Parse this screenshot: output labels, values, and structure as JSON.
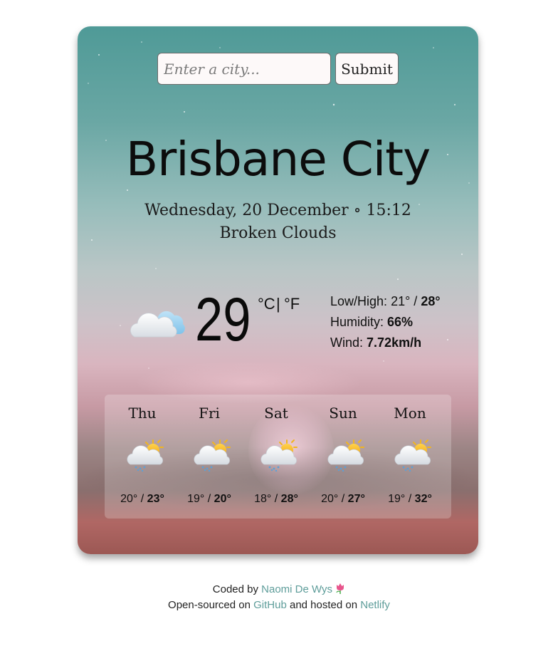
{
  "search": {
    "placeholder": "Enter a city...",
    "value": "",
    "submit_label": "Submit"
  },
  "current": {
    "city": "Brisbane City",
    "date_time": "Wednesday, 20 December ∘ 15:12",
    "description": "Broken Clouds",
    "icon": "cloud-icon",
    "temperature": "29",
    "unit_c": "°C",
    "unit_sep": "|",
    "unit_f": "°F",
    "low_high_label": "Low/High:",
    "low": "21°",
    "high": "28°",
    "humidity_label": "Humidity:",
    "humidity": "66%",
    "wind_label": "Wind:",
    "wind": "7.72km/h"
  },
  "forecast": [
    {
      "day": "Thu",
      "icon": "sun-cloud-rain-icon",
      "low": "20°",
      "high": "23°"
    },
    {
      "day": "Fri",
      "icon": "sun-cloud-rain-icon",
      "low": "19°",
      "high": "20°"
    },
    {
      "day": "Sat",
      "icon": "sun-cloud-rain-icon",
      "low": "18°",
      "high": "28°"
    },
    {
      "day": "Sun",
      "icon": "sun-cloud-rain-icon",
      "low": "20°",
      "high": "27°"
    },
    {
      "day": "Mon",
      "icon": "sun-cloud-rain-icon",
      "low": "19°",
      "high": "32°"
    }
  ],
  "footer": {
    "coded_by": "Coded by",
    "author": "Naomi De Wys",
    "open_sourced": "Open-sourced on",
    "github": "GitHub",
    "hosted": "and hosted on",
    "netlify": "Netlify"
  },
  "colors": {
    "link": "#5e9d9a",
    "card_top": "#4f9a97",
    "card_bottom": "#9c5854"
  }
}
